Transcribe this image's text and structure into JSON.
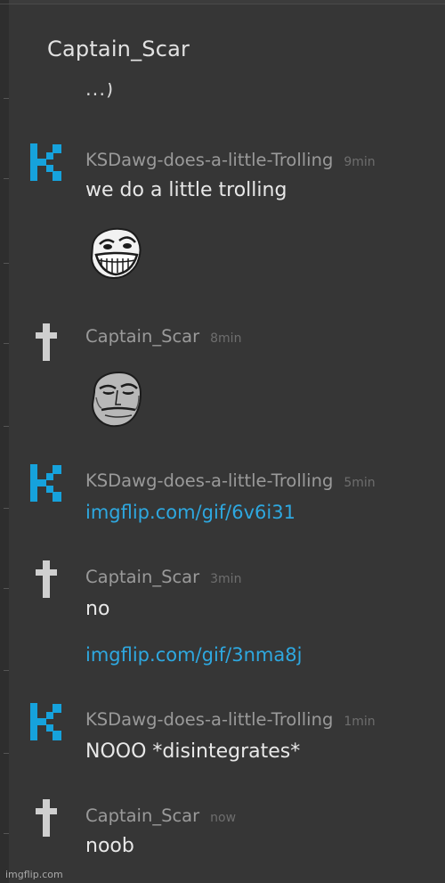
{
  "header": {
    "title": "Captain_Scar"
  },
  "cutoff_text": "...)",
  "colors": {
    "background": "#363636",
    "username": "#9a9a9a",
    "timestamp": "#6e6e6e",
    "message": "#e8e8e8",
    "link": "#2ea8e0",
    "ksdawg_avatar": "#16a2dc",
    "scar_avatar": "#cfcfcf"
  },
  "messages": [
    {
      "user": "KSDawg-does-a-little-Trolling",
      "time": "9min",
      "avatar": "k-logo-icon",
      "text": "we do a little trolling",
      "emoji": "trollface-emoji"
    },
    {
      "user": "Captain_Scar",
      "time": "8min",
      "avatar": "cross-icon",
      "emoji": "sad-trollface-emoji"
    },
    {
      "user": "KSDawg-does-a-little-Trolling",
      "time": "5min",
      "avatar": "k-logo-icon",
      "link": "imgflip.com/gif/6v6i31"
    },
    {
      "user": "Captain_Scar",
      "time": "3min",
      "avatar": "cross-icon",
      "text": "no",
      "link": "imgflip.com/gif/3nma8j"
    },
    {
      "user": "KSDawg-does-a-little-Trolling",
      "time": "1min",
      "avatar": "k-logo-icon",
      "text": "NOOO *disintegrates*"
    },
    {
      "user": "Captain_Scar",
      "time": "now",
      "avatar": "cross-icon",
      "text": "noob"
    }
  ],
  "watermark": "imgflip.com"
}
